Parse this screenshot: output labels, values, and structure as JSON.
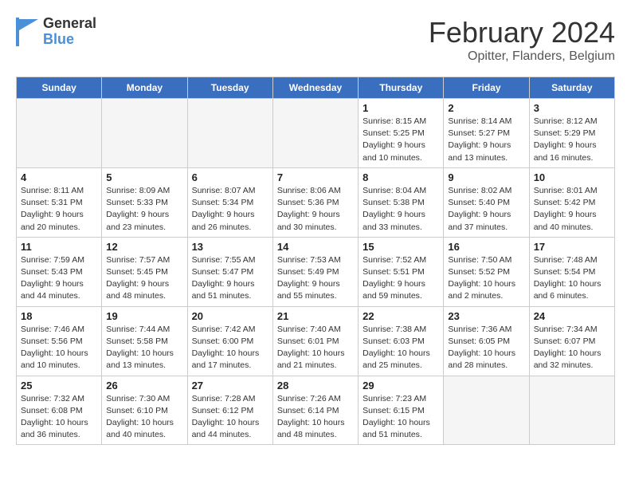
{
  "header": {
    "logo_general": "General",
    "logo_blue": "Blue",
    "title": "February 2024",
    "subtitle": "Opitter, Flanders, Belgium"
  },
  "weekdays": [
    "Sunday",
    "Monday",
    "Tuesday",
    "Wednesday",
    "Thursday",
    "Friday",
    "Saturday"
  ],
  "weeks": [
    [
      {
        "day": "",
        "info": ""
      },
      {
        "day": "",
        "info": ""
      },
      {
        "day": "",
        "info": ""
      },
      {
        "day": "",
        "info": ""
      },
      {
        "day": "1",
        "info": "Sunrise: 8:15 AM\nSunset: 5:25 PM\nDaylight: 9 hours\nand 10 minutes."
      },
      {
        "day": "2",
        "info": "Sunrise: 8:14 AM\nSunset: 5:27 PM\nDaylight: 9 hours\nand 13 minutes."
      },
      {
        "day": "3",
        "info": "Sunrise: 8:12 AM\nSunset: 5:29 PM\nDaylight: 9 hours\nand 16 minutes."
      }
    ],
    [
      {
        "day": "4",
        "info": "Sunrise: 8:11 AM\nSunset: 5:31 PM\nDaylight: 9 hours\nand 20 minutes."
      },
      {
        "day": "5",
        "info": "Sunrise: 8:09 AM\nSunset: 5:33 PM\nDaylight: 9 hours\nand 23 minutes."
      },
      {
        "day": "6",
        "info": "Sunrise: 8:07 AM\nSunset: 5:34 PM\nDaylight: 9 hours\nand 26 minutes."
      },
      {
        "day": "7",
        "info": "Sunrise: 8:06 AM\nSunset: 5:36 PM\nDaylight: 9 hours\nand 30 minutes."
      },
      {
        "day": "8",
        "info": "Sunrise: 8:04 AM\nSunset: 5:38 PM\nDaylight: 9 hours\nand 33 minutes."
      },
      {
        "day": "9",
        "info": "Sunrise: 8:02 AM\nSunset: 5:40 PM\nDaylight: 9 hours\nand 37 minutes."
      },
      {
        "day": "10",
        "info": "Sunrise: 8:01 AM\nSunset: 5:42 PM\nDaylight: 9 hours\nand 40 minutes."
      }
    ],
    [
      {
        "day": "11",
        "info": "Sunrise: 7:59 AM\nSunset: 5:43 PM\nDaylight: 9 hours\nand 44 minutes."
      },
      {
        "day": "12",
        "info": "Sunrise: 7:57 AM\nSunset: 5:45 PM\nDaylight: 9 hours\nand 48 minutes."
      },
      {
        "day": "13",
        "info": "Sunrise: 7:55 AM\nSunset: 5:47 PM\nDaylight: 9 hours\nand 51 minutes."
      },
      {
        "day": "14",
        "info": "Sunrise: 7:53 AM\nSunset: 5:49 PM\nDaylight: 9 hours\nand 55 minutes."
      },
      {
        "day": "15",
        "info": "Sunrise: 7:52 AM\nSunset: 5:51 PM\nDaylight: 9 hours\nand 59 minutes."
      },
      {
        "day": "16",
        "info": "Sunrise: 7:50 AM\nSunset: 5:52 PM\nDaylight: 10 hours\nand 2 minutes."
      },
      {
        "day": "17",
        "info": "Sunrise: 7:48 AM\nSunset: 5:54 PM\nDaylight: 10 hours\nand 6 minutes."
      }
    ],
    [
      {
        "day": "18",
        "info": "Sunrise: 7:46 AM\nSunset: 5:56 PM\nDaylight: 10 hours\nand 10 minutes."
      },
      {
        "day": "19",
        "info": "Sunrise: 7:44 AM\nSunset: 5:58 PM\nDaylight: 10 hours\nand 13 minutes."
      },
      {
        "day": "20",
        "info": "Sunrise: 7:42 AM\nSunset: 6:00 PM\nDaylight: 10 hours\nand 17 minutes."
      },
      {
        "day": "21",
        "info": "Sunrise: 7:40 AM\nSunset: 6:01 PM\nDaylight: 10 hours\nand 21 minutes."
      },
      {
        "day": "22",
        "info": "Sunrise: 7:38 AM\nSunset: 6:03 PM\nDaylight: 10 hours\nand 25 minutes."
      },
      {
        "day": "23",
        "info": "Sunrise: 7:36 AM\nSunset: 6:05 PM\nDaylight: 10 hours\nand 28 minutes."
      },
      {
        "day": "24",
        "info": "Sunrise: 7:34 AM\nSunset: 6:07 PM\nDaylight: 10 hours\nand 32 minutes."
      }
    ],
    [
      {
        "day": "25",
        "info": "Sunrise: 7:32 AM\nSunset: 6:08 PM\nDaylight: 10 hours\nand 36 minutes."
      },
      {
        "day": "26",
        "info": "Sunrise: 7:30 AM\nSunset: 6:10 PM\nDaylight: 10 hours\nand 40 minutes."
      },
      {
        "day": "27",
        "info": "Sunrise: 7:28 AM\nSunset: 6:12 PM\nDaylight: 10 hours\nand 44 minutes."
      },
      {
        "day": "28",
        "info": "Sunrise: 7:26 AM\nSunset: 6:14 PM\nDaylight: 10 hours\nand 48 minutes."
      },
      {
        "day": "29",
        "info": "Sunrise: 7:23 AM\nSunset: 6:15 PM\nDaylight: 10 hours\nand 51 minutes."
      },
      {
        "day": "",
        "info": ""
      },
      {
        "day": "",
        "info": ""
      }
    ]
  ]
}
